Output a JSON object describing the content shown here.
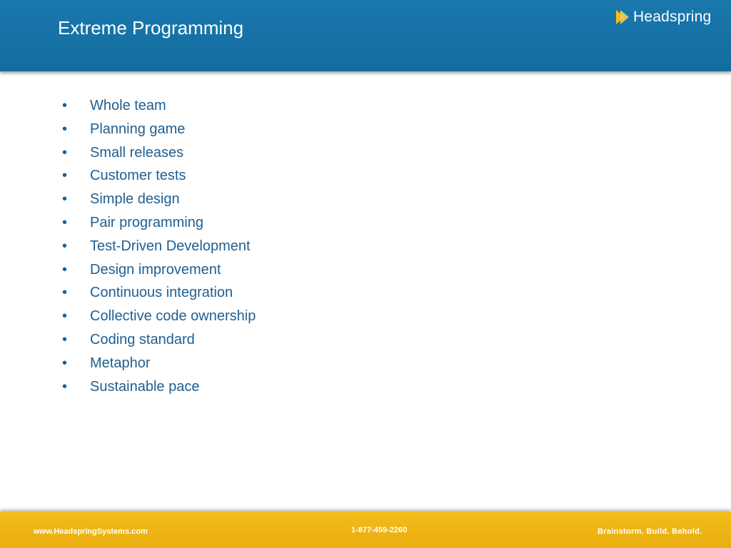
{
  "header": {
    "title": "Extreme Programming",
    "logo_text": "Headspring",
    "logo_icon": "headspring-logo-icon"
  },
  "bullets": [
    "Whole team",
    "Planning game",
    "Small releases",
    "Customer tests",
    "Simple design",
    "Pair programming",
    "Test-Driven Development",
    "Design improvement",
    "Continuous integration",
    "Collective code ownership",
    "Coding standard",
    "Metaphor",
    "Sustainable pace"
  ],
  "bullet_glyph": "•",
  "footer": {
    "url": "www.HeadspringSystems.com",
    "phone": "1-877-459-2260",
    "tagline": "Brainstorm. Build. Behold."
  },
  "colors": {
    "header_blue": "#1a78ad",
    "bullet_text_blue": "#1f5f91",
    "footer_yellow": "#f3bd1a"
  }
}
